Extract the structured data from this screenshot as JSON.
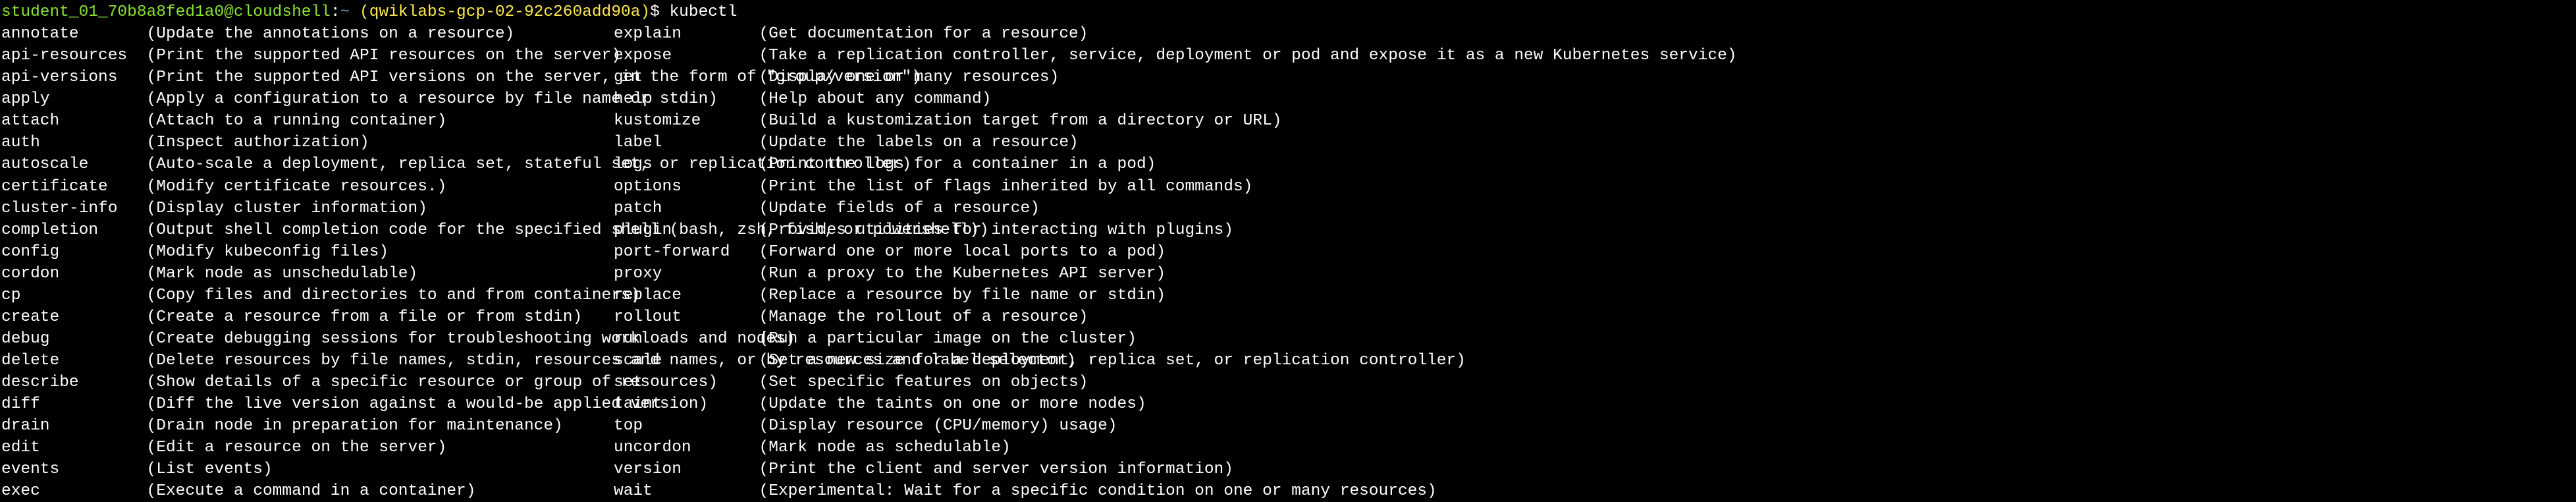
{
  "prompt": {
    "user": "student_01_70b8a8fed1a0@cloudshell",
    "colon": ":",
    "tilde": "~",
    "project_open": " (",
    "project": "qwiklabs-gcp-02-92c260add90a",
    "project_close": ")",
    "dollar": "$",
    "command": " kubectl"
  },
  "left": [
    {
      "cmd": "annotate",
      "desc": "(Update the annotations on a resource)"
    },
    {
      "cmd": "api-resources",
      "desc": "(Print the supported API resources on the server)"
    },
    {
      "cmd": "api-versions",
      "desc": "(Print the supported API versions on the server, in the form of \"group/version\")"
    },
    {
      "cmd": "apply",
      "desc": "(Apply a configuration to a resource by file name or stdin)"
    },
    {
      "cmd": "attach",
      "desc": "(Attach to a running container)"
    },
    {
      "cmd": "auth",
      "desc": "(Inspect authorization)"
    },
    {
      "cmd": "autoscale",
      "desc": "(Auto-scale a deployment, replica set, stateful set, or replication controller)"
    },
    {
      "cmd": "certificate",
      "desc": "(Modify certificate resources.)"
    },
    {
      "cmd": "cluster-info",
      "desc": "(Display cluster information)"
    },
    {
      "cmd": "completion",
      "desc": "(Output shell completion code for the specified shell (bash, zsh, fish, or powershell))"
    },
    {
      "cmd": "config",
      "desc": "(Modify kubeconfig files)"
    },
    {
      "cmd": "cordon",
      "desc": "(Mark node as unschedulable)"
    },
    {
      "cmd": "cp",
      "desc": "(Copy files and directories to and from containers)"
    },
    {
      "cmd": "create",
      "desc": "(Create a resource from a file or from stdin)"
    },
    {
      "cmd": "debug",
      "desc": "(Create debugging sessions for troubleshooting workloads and nodes)"
    },
    {
      "cmd": "delete",
      "desc": "(Delete resources by file names, stdin, resources and names, or by resources and label selector)"
    },
    {
      "cmd": "describe",
      "desc": "(Show details of a specific resource or group of resources)"
    },
    {
      "cmd": "diff",
      "desc": "(Diff the live version against a would-be applied version)"
    },
    {
      "cmd": "drain",
      "desc": "(Drain node in preparation for maintenance)"
    },
    {
      "cmd": "edit",
      "desc": "(Edit a resource on the server)"
    },
    {
      "cmd": "events",
      "desc": "(List events)"
    },
    {
      "cmd": "exec",
      "desc": "(Execute a command in a container)"
    }
  ],
  "right": [
    {
      "cmd": "explain",
      "desc": "(Get documentation for a resource)"
    },
    {
      "cmd": "expose",
      "desc": "(Take a replication controller, service, deployment or pod and expose it as a new Kubernetes service)"
    },
    {
      "cmd": "get",
      "desc": "(Display one or many resources)"
    },
    {
      "cmd": "help",
      "desc": "(Help about any command)"
    },
    {
      "cmd": "kustomize",
      "desc": "(Build a kustomization target from a directory or URL)"
    },
    {
      "cmd": "label",
      "desc": "(Update the labels on a resource)"
    },
    {
      "cmd": "logs",
      "desc": "(Print the logs for a container in a pod)"
    },
    {
      "cmd": "options",
      "desc": "(Print the list of flags inherited by all commands)"
    },
    {
      "cmd": "patch",
      "desc": "(Update fields of a resource)"
    },
    {
      "cmd": "plugin",
      "desc": "(Provides utilities for interacting with plugins)"
    },
    {
      "cmd": "port-forward",
      "desc": "(Forward one or more local ports to a pod)"
    },
    {
      "cmd": "proxy",
      "desc": "(Run a proxy to the Kubernetes API server)"
    },
    {
      "cmd": "replace",
      "desc": "(Replace a resource by file name or stdin)"
    },
    {
      "cmd": "rollout",
      "desc": "(Manage the rollout of a resource)"
    },
    {
      "cmd": "run",
      "desc": "(Run a particular image on the cluster)"
    },
    {
      "cmd": "scale",
      "desc": "(Set a new size for a deployment, replica set, or replication controller)"
    },
    {
      "cmd": "set",
      "desc": "(Set specific features on objects)"
    },
    {
      "cmd": "taint",
      "desc": "(Update the taints on one or more nodes)"
    },
    {
      "cmd": "top",
      "desc": "(Display resource (CPU/memory) usage)"
    },
    {
      "cmd": "uncordon",
      "desc": "(Mark node as schedulable)"
    },
    {
      "cmd": "version",
      "desc": "(Print the client and server version information)"
    },
    {
      "cmd": "wait",
      "desc": "(Experimental: Wait for a specific condition on one or many resources)"
    }
  ]
}
